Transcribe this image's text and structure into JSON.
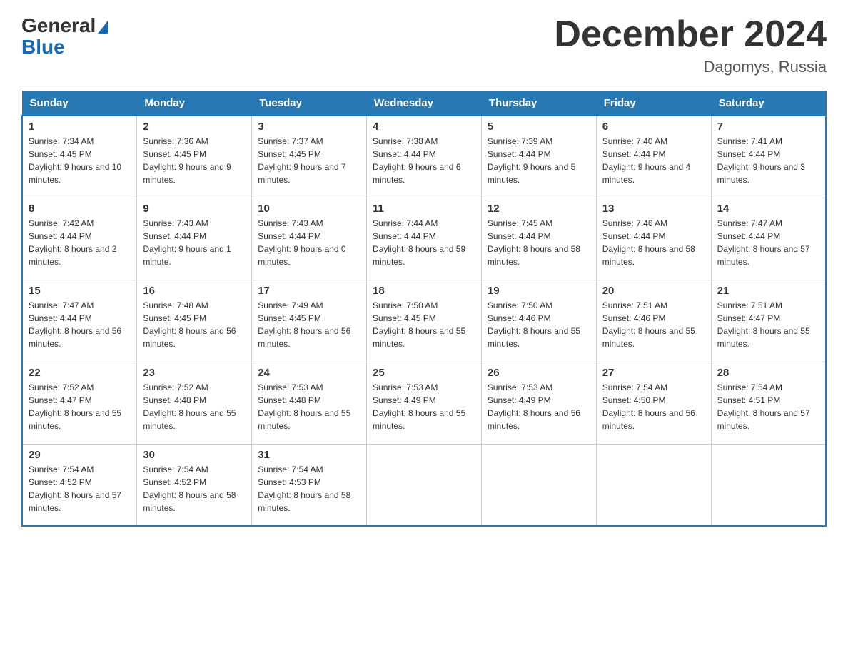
{
  "logo": {
    "text_general": "General",
    "text_blue": "Blue"
  },
  "title": "December 2024",
  "location": "Dagomys, Russia",
  "headers": [
    "Sunday",
    "Monday",
    "Tuesday",
    "Wednesday",
    "Thursday",
    "Friday",
    "Saturday"
  ],
  "weeks": [
    [
      {
        "day": "1",
        "sunrise": "7:34 AM",
        "sunset": "4:45 PM",
        "daylight": "9 hours and 10 minutes."
      },
      {
        "day": "2",
        "sunrise": "7:36 AM",
        "sunset": "4:45 PM",
        "daylight": "9 hours and 9 minutes."
      },
      {
        "day": "3",
        "sunrise": "7:37 AM",
        "sunset": "4:45 PM",
        "daylight": "9 hours and 7 minutes."
      },
      {
        "day": "4",
        "sunrise": "7:38 AM",
        "sunset": "4:44 PM",
        "daylight": "9 hours and 6 minutes."
      },
      {
        "day": "5",
        "sunrise": "7:39 AM",
        "sunset": "4:44 PM",
        "daylight": "9 hours and 5 minutes."
      },
      {
        "day": "6",
        "sunrise": "7:40 AM",
        "sunset": "4:44 PM",
        "daylight": "9 hours and 4 minutes."
      },
      {
        "day": "7",
        "sunrise": "7:41 AM",
        "sunset": "4:44 PM",
        "daylight": "9 hours and 3 minutes."
      }
    ],
    [
      {
        "day": "8",
        "sunrise": "7:42 AM",
        "sunset": "4:44 PM",
        "daylight": "8 hours and 2 minutes."
      },
      {
        "day": "9",
        "sunrise": "7:43 AM",
        "sunset": "4:44 PM",
        "daylight": "9 hours and 1 minute."
      },
      {
        "day": "10",
        "sunrise": "7:43 AM",
        "sunset": "4:44 PM",
        "daylight": "9 hours and 0 minutes."
      },
      {
        "day": "11",
        "sunrise": "7:44 AM",
        "sunset": "4:44 PM",
        "daylight": "8 hours and 59 minutes."
      },
      {
        "day": "12",
        "sunrise": "7:45 AM",
        "sunset": "4:44 PM",
        "daylight": "8 hours and 58 minutes."
      },
      {
        "day": "13",
        "sunrise": "7:46 AM",
        "sunset": "4:44 PM",
        "daylight": "8 hours and 58 minutes."
      },
      {
        "day": "14",
        "sunrise": "7:47 AM",
        "sunset": "4:44 PM",
        "daylight": "8 hours and 57 minutes."
      }
    ],
    [
      {
        "day": "15",
        "sunrise": "7:47 AM",
        "sunset": "4:44 PM",
        "daylight": "8 hours and 56 minutes."
      },
      {
        "day": "16",
        "sunrise": "7:48 AM",
        "sunset": "4:45 PM",
        "daylight": "8 hours and 56 minutes."
      },
      {
        "day": "17",
        "sunrise": "7:49 AM",
        "sunset": "4:45 PM",
        "daylight": "8 hours and 56 minutes."
      },
      {
        "day": "18",
        "sunrise": "7:50 AM",
        "sunset": "4:45 PM",
        "daylight": "8 hours and 55 minutes."
      },
      {
        "day": "19",
        "sunrise": "7:50 AM",
        "sunset": "4:46 PM",
        "daylight": "8 hours and 55 minutes."
      },
      {
        "day": "20",
        "sunrise": "7:51 AM",
        "sunset": "4:46 PM",
        "daylight": "8 hours and 55 minutes."
      },
      {
        "day": "21",
        "sunrise": "7:51 AM",
        "sunset": "4:47 PM",
        "daylight": "8 hours and 55 minutes."
      }
    ],
    [
      {
        "day": "22",
        "sunrise": "7:52 AM",
        "sunset": "4:47 PM",
        "daylight": "8 hours and 55 minutes."
      },
      {
        "day": "23",
        "sunrise": "7:52 AM",
        "sunset": "4:48 PM",
        "daylight": "8 hours and 55 minutes."
      },
      {
        "day": "24",
        "sunrise": "7:53 AM",
        "sunset": "4:48 PM",
        "daylight": "8 hours and 55 minutes."
      },
      {
        "day": "25",
        "sunrise": "7:53 AM",
        "sunset": "4:49 PM",
        "daylight": "8 hours and 55 minutes."
      },
      {
        "day": "26",
        "sunrise": "7:53 AM",
        "sunset": "4:49 PM",
        "daylight": "8 hours and 56 minutes."
      },
      {
        "day": "27",
        "sunrise": "7:54 AM",
        "sunset": "4:50 PM",
        "daylight": "8 hours and 56 minutes."
      },
      {
        "day": "28",
        "sunrise": "7:54 AM",
        "sunset": "4:51 PM",
        "daylight": "8 hours and 57 minutes."
      }
    ],
    [
      {
        "day": "29",
        "sunrise": "7:54 AM",
        "sunset": "4:52 PM",
        "daylight": "8 hours and 57 minutes."
      },
      {
        "day": "30",
        "sunrise": "7:54 AM",
        "sunset": "4:52 PM",
        "daylight": "8 hours and 58 minutes."
      },
      {
        "day": "31",
        "sunrise": "7:54 AM",
        "sunset": "4:53 PM",
        "daylight": "8 hours and 58 minutes."
      },
      null,
      null,
      null,
      null
    ]
  ],
  "labels": {
    "sunrise": "Sunrise:",
    "sunset": "Sunset:",
    "daylight": "Daylight:"
  }
}
